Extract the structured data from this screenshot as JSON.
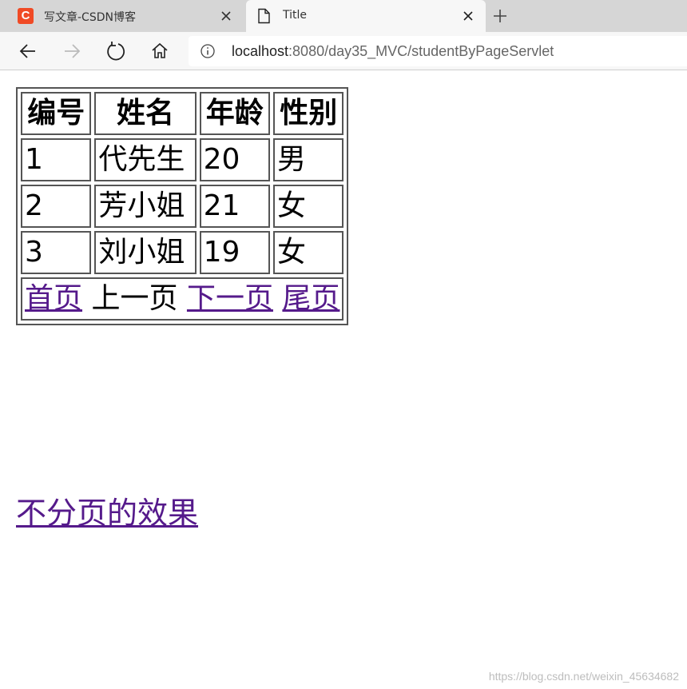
{
  "browser": {
    "tabs": [
      {
        "title": "写文章-CSDN博客",
        "favicon_letter": "C",
        "favicon_color": "#f04a25",
        "active": false
      },
      {
        "title": "Title",
        "active": true
      }
    ],
    "address": {
      "host": "localhost",
      "rest": ":8080/day35_MVC/studentByPageServlet"
    }
  },
  "table": {
    "headers": [
      "编号",
      "姓名",
      "年龄",
      "性别"
    ],
    "rows": [
      [
        "1",
        "代先生",
        "20",
        "男"
      ],
      [
        "2",
        "芳小姐",
        "21",
        "女"
      ],
      [
        "3",
        "刘小姐",
        "19",
        "女"
      ]
    ],
    "pagination": {
      "first": "首页",
      "prev": "上一页",
      "next": "下一页",
      "last": "尾页"
    }
  },
  "no_paging_link": "不分页的效果",
  "watermark": "https://blog.csdn.net/weixin_45634682",
  "colors": {
    "visited_link": "#551a8b",
    "csdn_brand": "#f04a25"
  }
}
